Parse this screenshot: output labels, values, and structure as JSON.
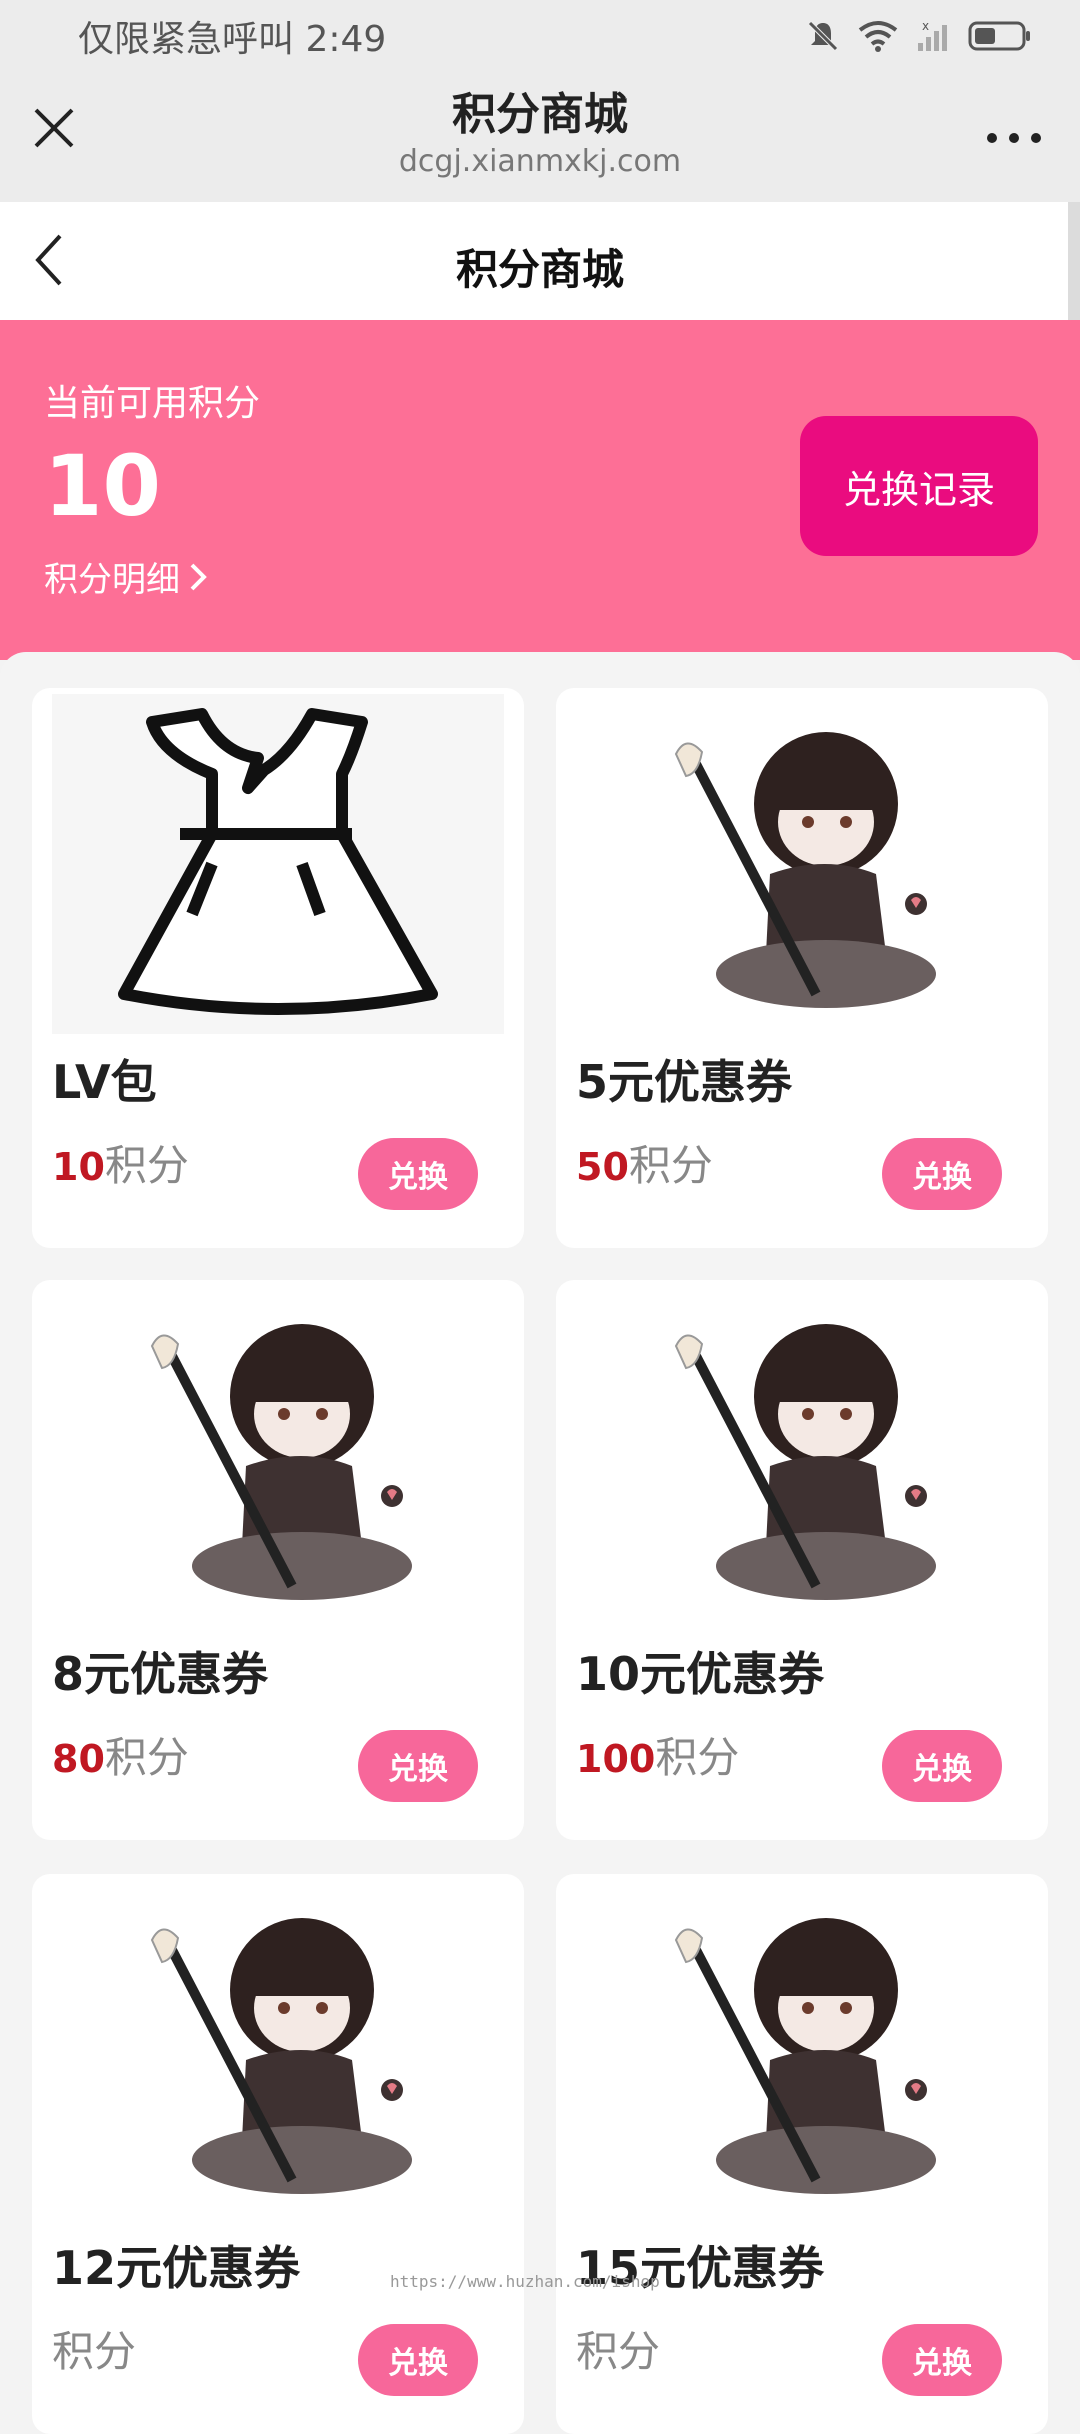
{
  "status_bar": {
    "text": "仅限紧急呼叫 2:49"
  },
  "browser": {
    "title": "积分商城",
    "url": "dcgj.xianmxkj.com"
  },
  "page": {
    "title": "积分商城"
  },
  "banner": {
    "label": "当前可用积分",
    "points": "10",
    "detail_link": "积分明细",
    "history_button": "兑换记录"
  },
  "products": [
    {
      "name": "LV包",
      "price": "10",
      "unit": "积分",
      "button": "兑换",
      "image": "dress-icon"
    },
    {
      "name": "5元优惠券",
      "price": "50",
      "unit": "积分",
      "button": "兑换",
      "image": "anime-character"
    },
    {
      "name": "8元优惠券",
      "price": "80",
      "unit": "积分",
      "button": "兑换",
      "image": "anime-character"
    },
    {
      "name": "10元优惠券",
      "price": "100",
      "unit": "积分",
      "button": "兑换",
      "image": "anime-character"
    },
    {
      "name": "12元优惠券",
      "price": "",
      "unit": "积分",
      "button": "兑换",
      "image": "anime-character"
    },
    {
      "name": "15元优惠券",
      "price": "",
      "unit": "积分",
      "button": "兑换",
      "image": "anime-character"
    }
  ],
  "colors": {
    "banner": "#fd6f96",
    "history_button": "#ea0c7f",
    "redeem_button": "#f7679a",
    "price": "#c01822"
  },
  "watermark": "https://www.huzhan.com/ishop"
}
